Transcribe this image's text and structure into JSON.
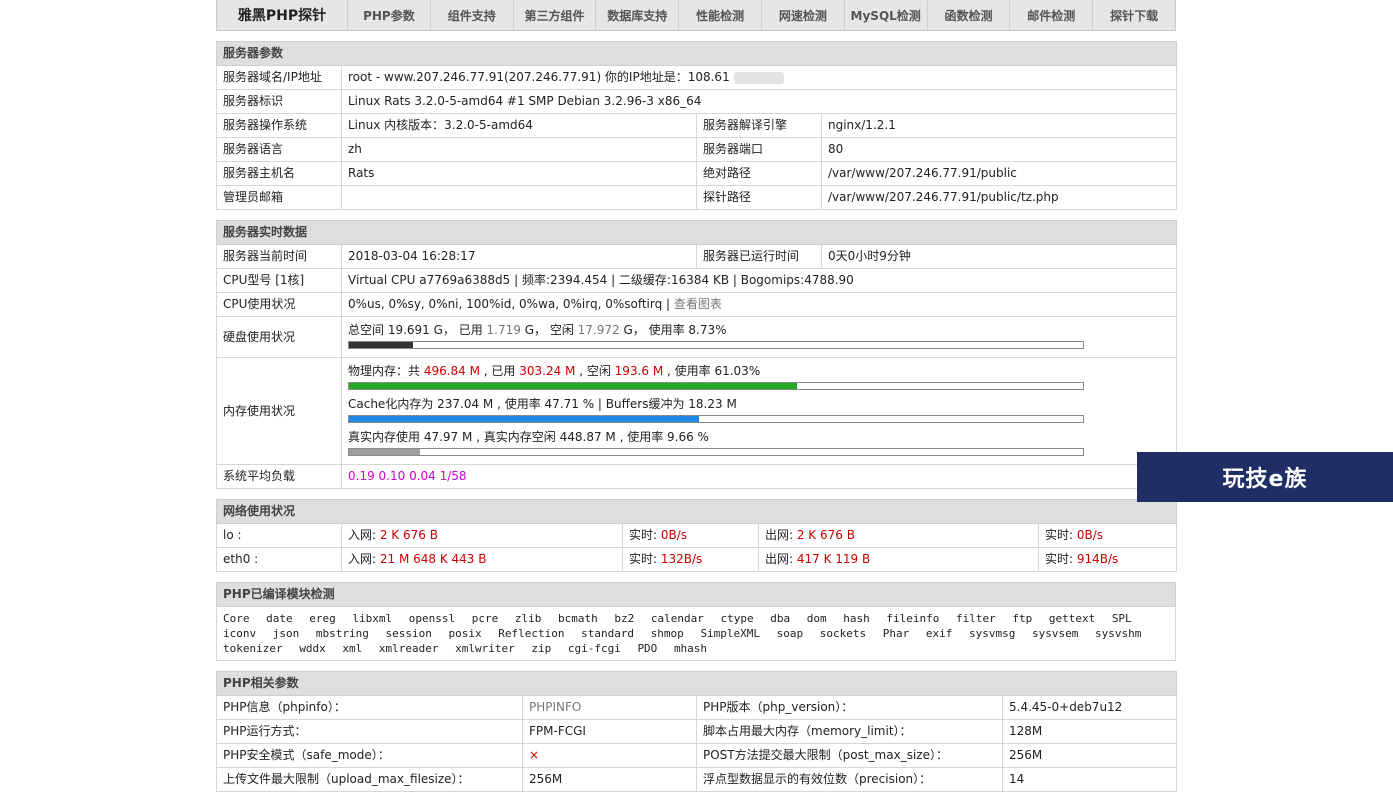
{
  "nav": {
    "brand": "雅黑PHP探针",
    "items": [
      "PHP参数",
      "组件支持",
      "第三方组件",
      "数据库支持",
      "性能检测",
      "网速检测",
      "MySQL检测",
      "函数检测",
      "邮件检测",
      "探针下载"
    ]
  },
  "server": {
    "title": "服务器参数",
    "domain_label": "服务器域名/IP地址",
    "domain_value": "root - www.207.246.77.91(207.246.77.91)  你的IP地址是：108.61",
    "id_label": "服务器标识",
    "id_value": "Linux Rats 3.2.0-5-amd64 #1 SMP Debian 3.2.96-3 x86_64",
    "os_label": "服务器操作系统",
    "os_value": "Linux  内核版本：3.2.0-5-amd64",
    "engine_label": "服务器解译引擎",
    "engine_value": "nginx/1.2.1",
    "lang_label": "服务器语言",
    "lang_value": "zh",
    "port_label": "服务器端口",
    "port_value": "80",
    "host_label": "服务器主机名",
    "host_value": "Rats",
    "abs_path_label": "绝对路径",
    "abs_path_value": "/var/www/207.246.77.91/public",
    "admin_label": "管理员邮箱",
    "admin_value": "",
    "probe_path_label": "探针路径",
    "probe_path_value": "/var/www/207.246.77.91/public/tz.php"
  },
  "realtime": {
    "title": "服务器实时数据",
    "time_label": "服务器当前时间",
    "time_value": "2018-03-04 16:28:17",
    "uptime_label": "服务器已运行时间",
    "uptime_value": "0天0小时9分钟",
    "cpu_label": "CPU型号 [1核]",
    "cpu_value": "Virtual CPU a7769a6388d5 | 频率:2394.454 | 二级缓存:16384 KB | Bogomips:4788.90",
    "cpu_usage_label": "CPU使用状况",
    "cpu_usage_value": "0%us, 0%sy, 0%ni, 100%id, 0%wa, 0%irq, 0%softirq | ",
    "cpu_chart_link": "查看图表",
    "disk_label": "硬盘使用状况",
    "disk_total_prefix": "总空间 19.691 G， 已用 ",
    "disk_used": "1.719",
    "disk_mid": " G， 空闲 ",
    "disk_free": "17.972",
    "disk_rate": " G， 使用率 8.73%",
    "disk_pct": 8.73,
    "mem_label": "内存使用状况",
    "mem_phys_prefix": "物理内存：共 ",
    "mem_phys_total": "496.84 M",
    "mem_phys_used_pre": " , 已用 ",
    "mem_phys_used": "303.24 M",
    "mem_phys_free_pre": " , 空闲 ",
    "mem_phys_free": "193.6 M",
    "mem_phys_rate": " , 使用率 61.03%",
    "mem_phys_pct": 61.03,
    "mem_cache_text": "Cache化内存为 237.04 M , 使用率 47.71 % | Buffers缓冲为 18.23 M",
    "mem_cache_pct": 47.71,
    "mem_real_text": "真实内存使用 47.97 M , 真实内存空闲 448.87 M , 使用率 9.66 %",
    "mem_real_pct": 9.66,
    "load_label": "系统平均负载",
    "load_value": "0.19 0.10 0.04 1/58"
  },
  "network": {
    "title": "网络使用状况",
    "rows": [
      {
        "iface": "lo :",
        "in_label": "入网: ",
        "in": "2 K 676 B",
        "rt1_label": "实时: ",
        "rt1": "0B/s",
        "out_label": "出网: ",
        "out": "2 K 676 B",
        "rt2_label": "实时: ",
        "rt2": "0B/s"
      },
      {
        "iface": "eth0 :",
        "in_label": "入网: ",
        "in": "21 M 648 K 443 B",
        "rt1_label": "实时: ",
        "rt1": "132B/s",
        "out_label": "出网: ",
        "out": "417 K 119 B",
        "rt2_label": "实时: ",
        "rt2": "914B/s"
      }
    ]
  },
  "modules": {
    "title": "PHP已编译模块检测",
    "list": [
      "Core",
      "date",
      "ereg",
      "libxml",
      "openssl",
      "pcre",
      "zlib",
      "bcmath",
      "bz2",
      "calendar",
      "ctype",
      "dba",
      "dom",
      "hash",
      "fileinfo",
      "filter",
      "ftp",
      "gettext",
      "SPL",
      "iconv",
      "json",
      "mbstring",
      "session",
      "posix",
      "Reflection",
      "standard",
      "shmop",
      "SimpleXML",
      "soap",
      "sockets",
      "Phar",
      "exif",
      "sysvmsg",
      "sysvsem",
      "sysvshm",
      "tokenizer",
      "wddx",
      "xml",
      "xmlreader",
      "xmlwriter",
      "zip",
      "cgi-fcgi",
      "PDO",
      "mhash"
    ]
  },
  "php": {
    "title": "PHP相关参数",
    "phpinfo_label": "PHP信息（phpinfo）：",
    "phpinfo_value": "PHPINFO",
    "version_label": "PHP版本（php_version）：",
    "version_value": "5.4.45-0+deb7u12",
    "mode_label": "PHP运行方式：",
    "mode_value": "FPM-FCGI",
    "memlimit_label": "脚本占用最大内存（memory_limit）：",
    "memlimit_value": "128M",
    "safe_label": "PHP安全模式（safe_mode）：",
    "safe_value": "×",
    "post_label": "POST方法提交最大限制（post_max_size）：",
    "post_value": "256M",
    "upload_label": "上传文件最大限制（upload_max_filesize）：",
    "upload_value": "256M",
    "precision_label": "浮点型数据显示的有效位数（precision）：",
    "precision_value": "14"
  },
  "badge": {
    "text": "玩技e族"
  },
  "colors": {
    "green_bar": "#22aa22",
    "blue_bar": "#1e88e5",
    "gray_bar": "#9e9e9e",
    "dark_bar": "#333333"
  }
}
